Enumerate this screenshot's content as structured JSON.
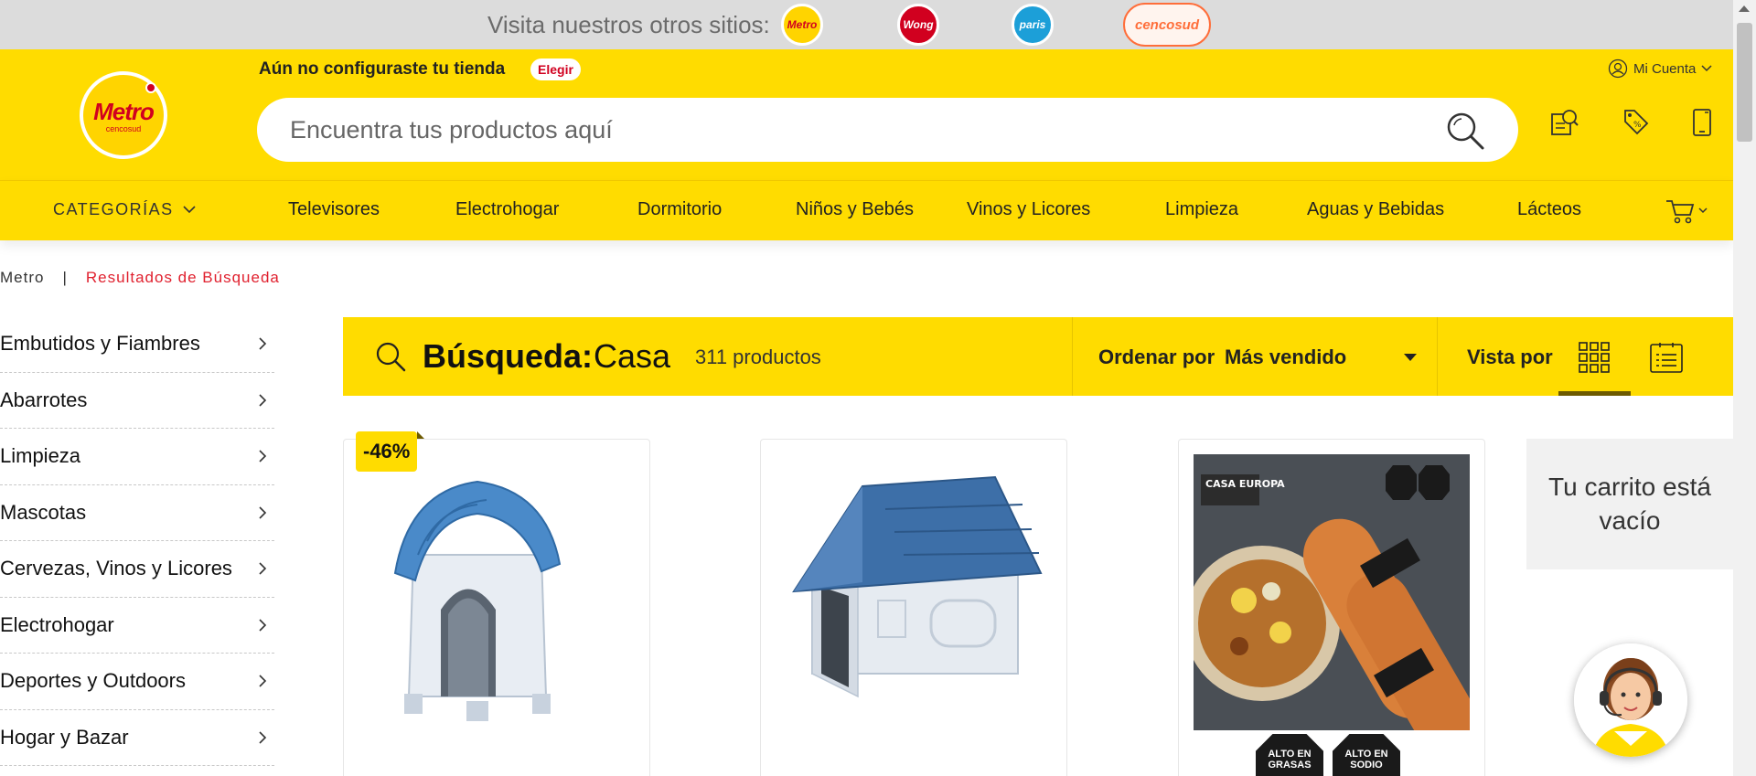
{
  "sites_bar": {
    "label": "Visita nuestros otros sitios:",
    "sites": [
      {
        "name": "Metro",
        "icon": "metro-logo"
      },
      {
        "name": "Wong",
        "icon": "wong-logo"
      },
      {
        "name": "paris",
        "icon": "paris-logo"
      },
      {
        "name": "cencosud",
        "icon": "tarjeta-cencosud-logo"
      }
    ]
  },
  "header": {
    "brand_logo": "metro-cencosud-logo",
    "brand_name": "Metro",
    "brand_sub": "cencosud",
    "store_message": "Aún no configuraste tu tienda",
    "store_button": "Elegir",
    "search_placeholder": "Encuentra tus productos aquí",
    "account_label": "Mi Cuenta",
    "icons": [
      "catalog-search-icon",
      "coupon-tag-icon",
      "phone-icon"
    ]
  },
  "nav": {
    "categories_label": "CATEGORÍAS",
    "items": [
      "Televisores",
      "Electrohogar",
      "Dormitorio",
      "Niños y Bebés",
      "Vinos y Licores",
      "Limpieza",
      "Aguas y Bebidas",
      "Lácteos"
    ]
  },
  "breadcrumb": {
    "home": "Metro",
    "separator": "|",
    "current": "Resultados de Búsqueda"
  },
  "sidebar": {
    "items": [
      "Embutidos y Fiambres",
      "Abarrotes",
      "Limpieza",
      "Mascotas",
      "Cervezas, Vinos y Licores",
      "Electrohogar",
      "Deportes y Outdoors",
      "Hogar y Bazar"
    ]
  },
  "results": {
    "label": "Búsqueda:",
    "term": "Casa",
    "count": "311 productos",
    "order_label": "Ordenar por",
    "order_value": "Más vendido",
    "view_label": "Vista por"
  },
  "products": [
    {
      "discount": "-46%",
      "image": "plastic-dog-house-blue-roof"
    },
    {
      "discount": "",
      "image": "large-dog-house-blue-tiles"
    },
    {
      "discount": "",
      "image": "casa-europa-sausages",
      "brand_text": "CASA EUROPA",
      "warnings": [
        "ALTO EN GRASAS",
        "ALTO EN SODIO"
      ]
    }
  ],
  "cart": {
    "empty_message": "Tu carrito está vacío"
  },
  "colors": {
    "brand_yellow": "#ffdc00",
    "brand_red": "#d1001f",
    "breadcrumb_current": "#e0202e"
  }
}
